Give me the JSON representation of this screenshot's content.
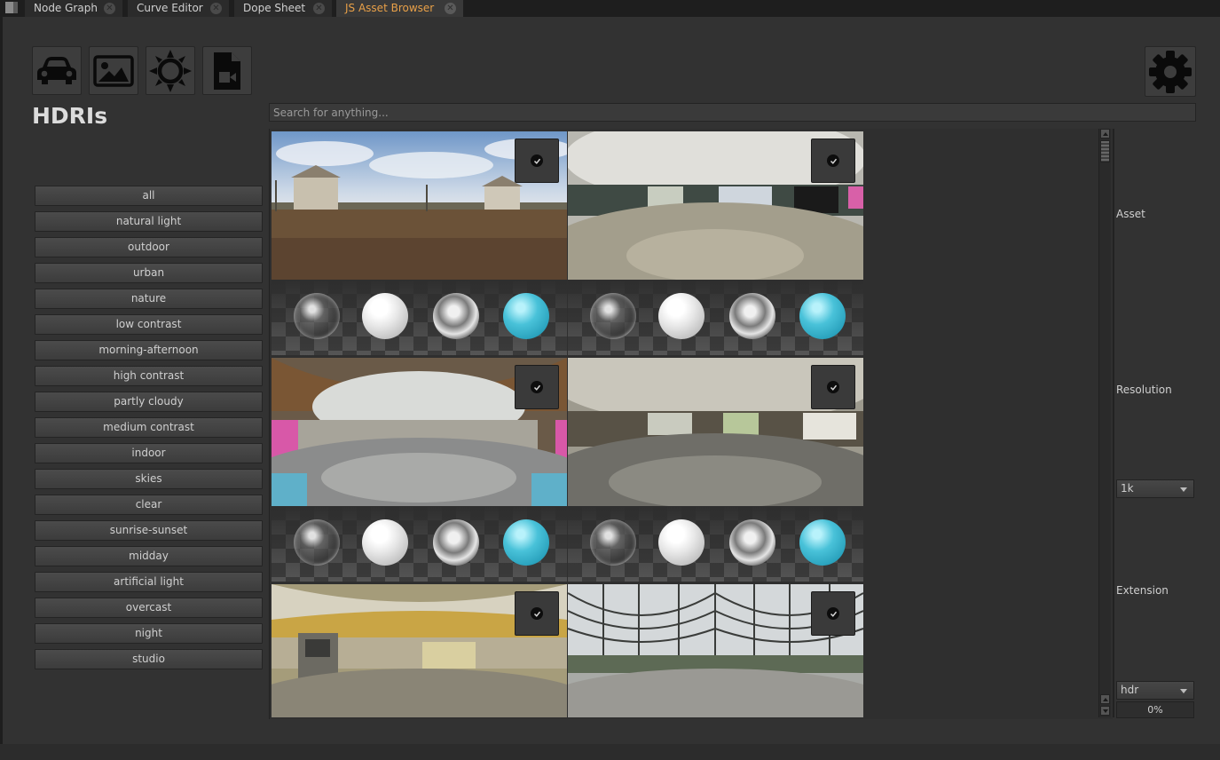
{
  "tabs": [
    {
      "label": "Node Graph",
      "close": "✕"
    },
    {
      "label": "Curve Editor",
      "close": "✕"
    },
    {
      "label": "Dope Sheet",
      "close": "✕"
    },
    {
      "label": "JS Asset Browser",
      "close": "✕"
    }
  ],
  "toolbar": {
    "icons": [
      "car-icon",
      "image-icon",
      "sun-icon",
      "video-file-icon"
    ],
    "settings_icon": "gear-icon"
  },
  "section_title": "HDRIs",
  "search": {
    "placeholder": "Search for anything...",
    "value": ""
  },
  "categories": [
    "all",
    "natural light",
    "outdoor",
    "urban",
    "nature",
    "low contrast",
    "morning-afternoon",
    "high contrast",
    "partly cloudy",
    "medium contrast",
    "indoor",
    "skies",
    "clear",
    "sunrise-sunset",
    "midday",
    "artificial light",
    "overcast",
    "night",
    "studio"
  ],
  "assets": [
    {
      "scene": "outdoor field with buildings under cloudy sky",
      "selected": true
    },
    {
      "scene": "abandoned indoor hall with murals",
      "selected": true
    },
    {
      "scene": "indoor warehouse with wooden beams",
      "selected": true
    },
    {
      "scene": "abandoned school room",
      "selected": true
    },
    {
      "scene": "abandoned room with old machine",
      "selected": true
    },
    {
      "scene": "abandoned greenhouse",
      "selected": true
    }
  ],
  "right_panel": {
    "asset_label": "Asset",
    "resolution_label": "Resolution",
    "resolution_value": "1k",
    "extension_label": "Extension",
    "extension_value": "hdr",
    "progress": "0%"
  },
  "colors": {
    "background": "#323232",
    "active_tab_text": "#e8a048",
    "sphere_blue": "#3bb5cf"
  }
}
